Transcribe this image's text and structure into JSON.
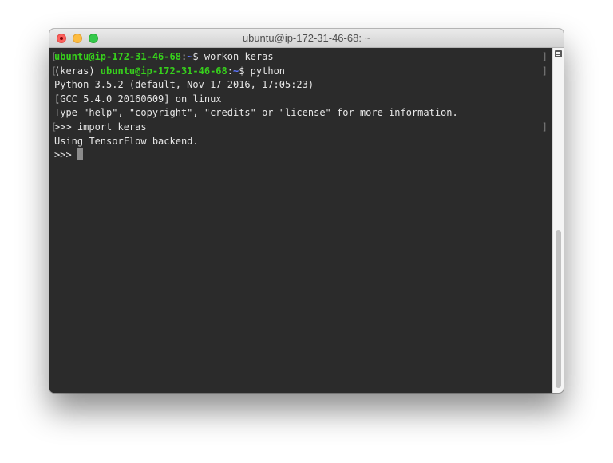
{
  "window": {
    "title": "ubuntu@ip-172-31-46-68: ~"
  },
  "terminal": {
    "lines": [
      {
        "mark_left": "[",
        "user_host": "ubuntu@ip-172-31-46-68",
        "sep": ":",
        "path": "~",
        "prompt": "$",
        "rest": " workon keras",
        "mark_right": "]"
      },
      {
        "mark_left": "[",
        "venv": "(keras) ",
        "user_host": "ubuntu@ip-172-31-46-68",
        "sep": ":",
        "path": "~",
        "prompt": "$",
        "rest": " python",
        "mark_right": "]"
      },
      {
        "text": "Python 3.5.2 (default, Nov 17 2016, 17:05:23)"
      },
      {
        "text": "[GCC 5.4.0 20160609] on linux"
      },
      {
        "text": "Type \"help\", \"copyright\", \"credits\" or \"license\" for more information."
      },
      {
        "mark_left": "[",
        "text": ">>> import keras",
        "mark_right": "]"
      },
      {
        "text": "Using TensorFlow backend."
      },
      {
        "text": ">>> "
      }
    ]
  },
  "colors": {
    "terminal_bg": "#2b2b2b",
    "text": "#e6e6e6",
    "user_host": "#37d01c",
    "path": "#5f76ff",
    "close": "#fc605c",
    "minimize": "#fdbc40",
    "maximize": "#34c84a"
  }
}
